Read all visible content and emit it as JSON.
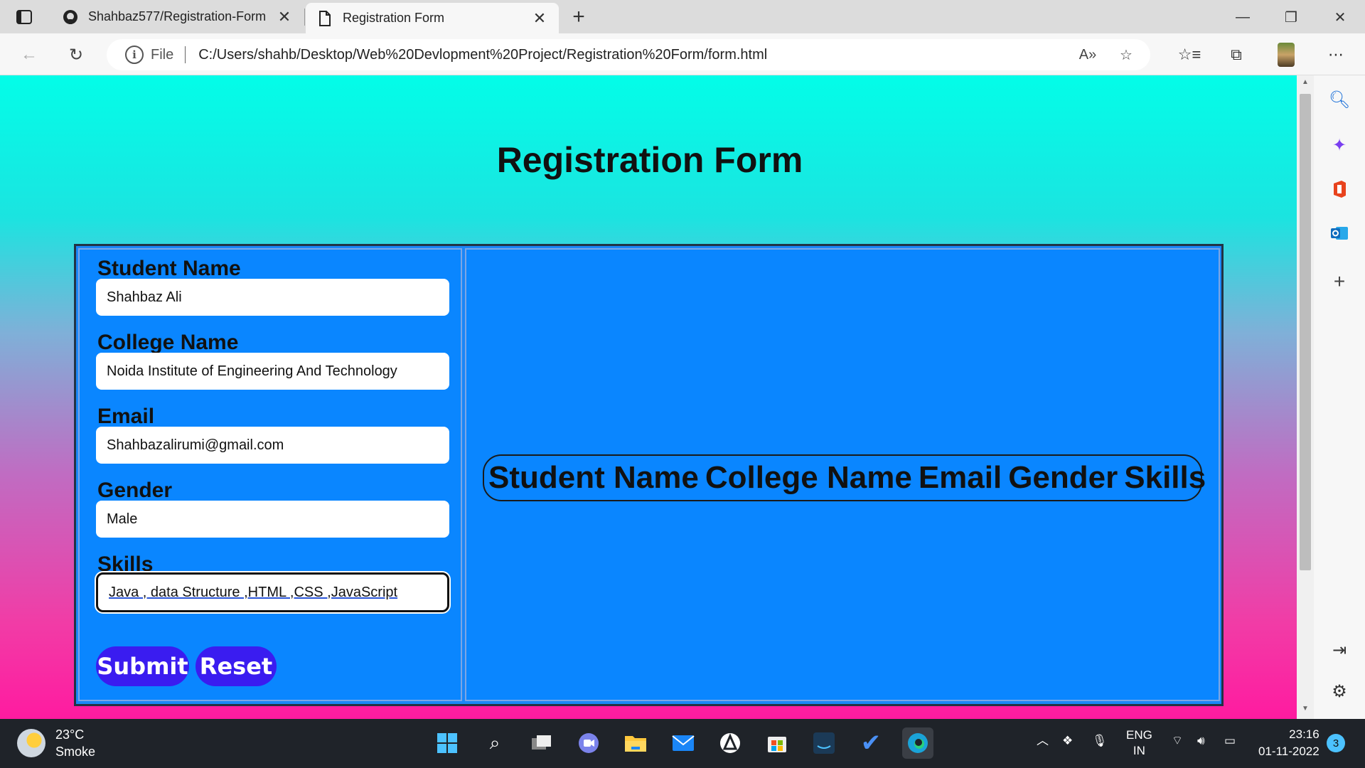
{
  "browser": {
    "tabs": [
      {
        "label": "Shahbaz577/Registration-Form",
        "icon": "github-icon",
        "active": false
      },
      {
        "label": "Registration Form",
        "icon": "page-icon",
        "active": true
      }
    ],
    "address": {
      "scheme_label": "File",
      "url": "C:/Users/shahb/Desktop/Web%20Devlopment%20Project/Registration%20Form/form.html"
    }
  },
  "page": {
    "title": "Registration Form",
    "form": {
      "student_name": {
        "label": "Student Name",
        "value": "Shahbaz Ali"
      },
      "college_name": {
        "label": "College Name",
        "value": "Noida Institute of Engineering And Technology"
      },
      "email": {
        "label": "Email",
        "value": "Shahbazalirumi@gmail.com"
      },
      "gender": {
        "label": "Gender",
        "value": "Male"
      },
      "skills": {
        "label": "Skills",
        "value": "Java , data Structure ,HTML ,CSS ,JavaScript"
      },
      "submit_label": "Submit",
      "reset_label": "Reset"
    },
    "table_headers": [
      "Student Name",
      "College Name",
      "Email",
      "Gender",
      "Skills"
    ]
  },
  "taskbar": {
    "weather": {
      "temp": "23°C",
      "condition": "Smoke"
    },
    "language": {
      "line1": "ENG",
      "line2": "IN"
    },
    "time": "23:16",
    "date": "01-11-2022",
    "notifications": "3"
  },
  "colors": {
    "panel_blue": "#0a86ff",
    "button_purple": "#3a1cf0",
    "gradient_top": "#03fde8",
    "gradient_bottom": "#ff1ba0"
  }
}
